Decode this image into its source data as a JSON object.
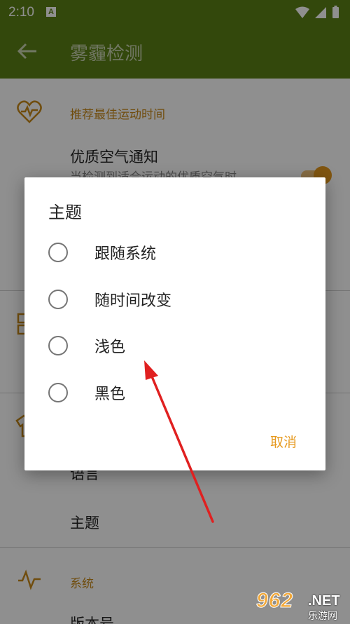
{
  "status_bar": {
    "time": "2:10",
    "notification_badge": "A",
    "icons": [
      "wifi-icon",
      "signal-icon",
      "battery-icon"
    ]
  },
  "app_bar": {
    "title": "雾霾检测",
    "back_icon": "arrow-left-icon"
  },
  "settings": {
    "sections": [
      {
        "icon": "heart-pulse-icon",
        "title": "推荐最佳运动时间",
        "rows": [
          {
            "title": "优质空气通知",
            "subtitle": "当检测到适合运动的优质空气时",
            "toggle_on": true
          }
        ]
      },
      {
        "icon": "grid-icon",
        "title": "",
        "rows": []
      },
      {
        "icon": "shirt-icon",
        "title": "",
        "rows": [
          {
            "title": "语言"
          },
          {
            "title": "主题"
          }
        ]
      },
      {
        "icon": "activity-icon",
        "title": "系统",
        "rows": [
          {
            "title": "版本号"
          }
        ]
      }
    ]
  },
  "dialog": {
    "title": "主题",
    "options": [
      {
        "label": "跟随系统",
        "selected": false
      },
      {
        "label": "随时间改变",
        "selected": false
      },
      {
        "label": "浅色",
        "selected": false
      },
      {
        "label": "黑色",
        "selected": false
      }
    ],
    "cancel_label": "取消"
  },
  "watermark": {
    "main": "962",
    "net": ".NET",
    "sub": "乐游网"
  },
  "colors": {
    "primary": "#5c8016",
    "accent": "#e6991e",
    "annotation_arrow": "#e02020"
  }
}
